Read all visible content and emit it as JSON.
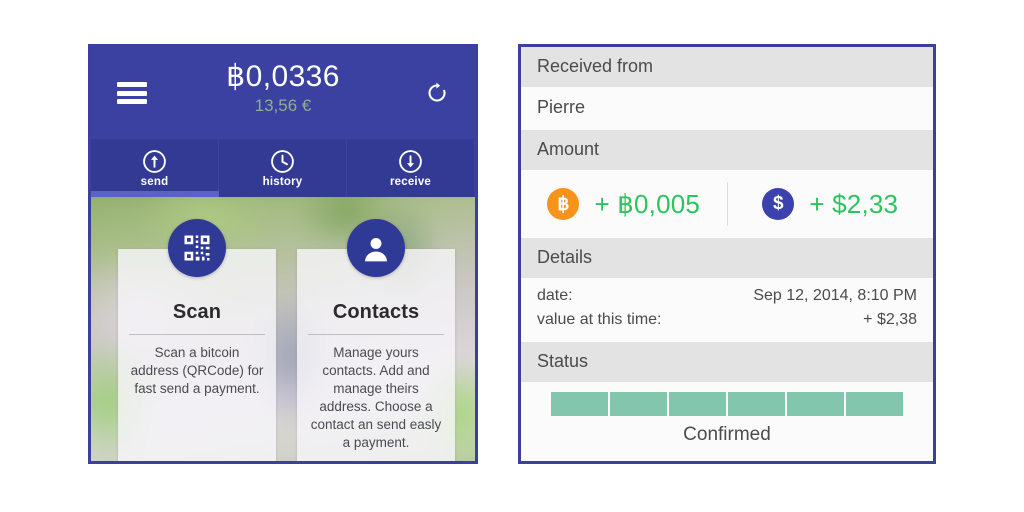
{
  "wallet": {
    "header": {
      "menu_icon": "hamburger-menu-icon",
      "balance_btc": "฿0,0336",
      "balance_fiat": "13,56 €",
      "refresh_icon": "refresh-icon"
    },
    "tabs": [
      {
        "label": "send",
        "icon": "arrow-up-circle-icon",
        "active": true
      },
      {
        "label": "history",
        "icon": "clock-circle-icon",
        "active": false
      },
      {
        "label": "receive",
        "icon": "arrow-down-circle-icon",
        "active": false
      }
    ],
    "cards": [
      {
        "title": "Scan",
        "icon": "qr-code-icon",
        "description": "Scan a bitcoin address (QRCode) for fast send a payment."
      },
      {
        "title": "Contacts",
        "icon": "person-icon",
        "description": "Manage yours contacts. Add and manage theirs address. Choose a contact an send easly a payment."
      }
    ]
  },
  "transaction": {
    "received_from_label": "Received from",
    "sender": "Pierre",
    "amount_label": "Amount",
    "amounts": [
      {
        "icon": "bitcoin-coin-icon",
        "symbol": "฿",
        "value": "+ ฿0,005"
      },
      {
        "icon": "dollar-coin-icon",
        "symbol": "$",
        "value": "+ $2,33"
      }
    ],
    "details_label": "Details",
    "details": [
      {
        "key": "date:",
        "value": "Sep 12, 2014, 8:10 PM"
      },
      {
        "key": "value at this time:",
        "value": "+ $2,38"
      }
    ],
    "status_label": "Status",
    "status_value": "Confirmed",
    "progress_segments": 6,
    "progress_filled": 6
  },
  "colors": {
    "brand_blue": "#3a41a0",
    "tabbar_blue": "#323a93",
    "tab_indicator": "#5a62c8",
    "panel_border": "#3b3fa0",
    "amount_green": "#2cc45e",
    "progress_green": "#83c6ae",
    "bitcoin_orange": "#f7931a",
    "dollar_blue": "#3b42ad",
    "fiat_green": "#8fae8f",
    "row_header_grey": "#e3e3e3",
    "row_body_white": "#fbfbfb"
  }
}
